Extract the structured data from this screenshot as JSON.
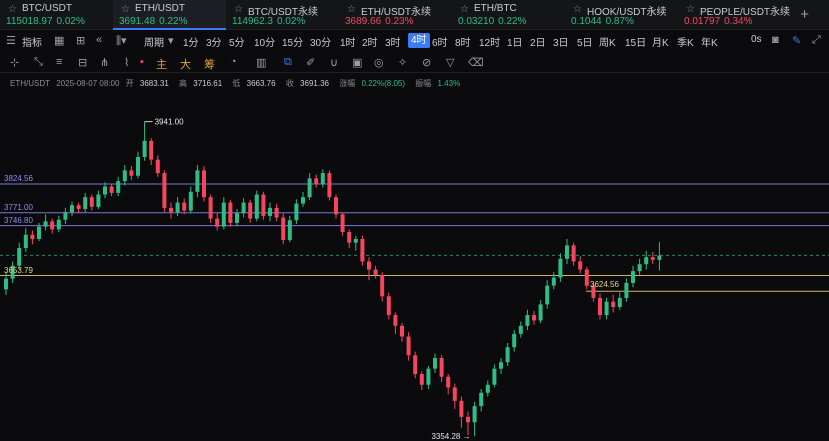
{
  "tickers": [
    {
      "name": "BTC/USDT",
      "price": "115018.97",
      "change": "0.02%",
      "dir": "up",
      "active": false
    },
    {
      "name": "ETH/USDT",
      "price": "3691.48",
      "change": "0.22%",
      "dir": "up",
      "active": true
    },
    {
      "name": "BTC/USDT永续",
      "price": "114962.3",
      "change": "0.02%",
      "dir": "up",
      "active": false
    },
    {
      "name": "ETH/USDT永续",
      "price": "3689.66",
      "change": "0.23%",
      "dir": "down",
      "active": false
    },
    {
      "name": "ETH/BTC",
      "price": "0.03210",
      "change": "0.22%",
      "dir": "up",
      "active": false
    },
    {
      "name": "HOOK/USDT永续",
      "price": "0.1044",
      "change": "0.87%",
      "dir": "up",
      "active": false
    },
    {
      "name": "PEOPLE/USDT永续",
      "price": "0.01797",
      "change": "0.34%",
      "dir": "down",
      "active": false
    }
  ],
  "toolbar": {
    "indicators_label": "指标",
    "period_label": "周期",
    "intervals": [
      "1分",
      "3分",
      "5分",
      "10分",
      "15分",
      "30分",
      "1时",
      "2时",
      "3时",
      "4时",
      "6时",
      "8时",
      "12时",
      "1日",
      "2日",
      "3日",
      "5日",
      "周K",
      "15日",
      "月K",
      "季K",
      "年K"
    ],
    "active_interval": "4时",
    "timer": "0s"
  },
  "drawtools": {
    "zhu": "主",
    "da": "大",
    "chou": "筹"
  },
  "info": {
    "symbol": "ETH/USDT",
    "datetime": "2025-08-07 08:00",
    "open_label": "开",
    "open": "3683.31",
    "high_label": "高",
    "high": "3716.61",
    "low_label": "低",
    "low": "3663.76",
    "close_label": "收",
    "close": "3691.36",
    "change_label": "涨幅",
    "change": "0.22%(8.05)",
    "amp_label": "振幅",
    "amp": "1.43%"
  },
  "chart_data": {
    "type": "candlestick",
    "price_range": [
      3345,
      4000
    ],
    "annotations": {
      "high": "3941.00",
      "low": "3354.28"
    },
    "levels": [
      {
        "label": "3824.56",
        "value": 3824.56,
        "color": "#8c8cf0"
      },
      {
        "label": "3771.00",
        "value": 3771.0,
        "color": "#8c8cf0"
      },
      {
        "label": "3746.80",
        "value": 3746.8,
        "color": "#8c8cf0"
      },
      {
        "label": "3653.79",
        "value": 3653.79,
        "color": "#e8d37a"
      },
      {
        "label": "3624.56",
        "value": 3624.56,
        "color": "#e8d37a"
      }
    ],
    "current_price": 3691.36,
    "candles": [
      [
        3628,
        3648,
        3618,
        3660
      ],
      [
        3648,
        3672,
        3640,
        3680
      ],
      [
        3672,
        3705,
        3665,
        3715
      ],
      [
        3705,
        3730,
        3698,
        3742
      ],
      [
        3730,
        3722,
        3712,
        3738
      ],
      [
        3722,
        3745,
        3718,
        3752
      ],
      [
        3745,
        3755,
        3738,
        3768
      ],
      [
        3755,
        3740,
        3732,
        3760
      ],
      [
        3740,
        3758,
        3735,
        3765
      ],
      [
        3758,
        3772,
        3750,
        3780
      ],
      [
        3772,
        3785,
        3765,
        3792
      ],
      [
        3785,
        3778,
        3770,
        3790
      ],
      [
        3778,
        3800,
        3772,
        3808
      ],
      [
        3800,
        3782,
        3775,
        3805
      ],
      [
        3782,
        3805,
        3778,
        3812
      ],
      [
        3805,
        3820,
        3798,
        3828
      ],
      [
        3820,
        3808,
        3802,
        3825
      ],
      [
        3808,
        3830,
        3802,
        3838
      ],
      [
        3830,
        3850,
        3822,
        3860
      ],
      [
        3850,
        3840,
        3832,
        3858
      ],
      [
        3840,
        3875,
        3835,
        3885
      ],
      [
        3875,
        3905,
        3868,
        3941
      ],
      [
        3905,
        3870,
        3860,
        3910
      ],
      [
        3870,
        3845,
        3838,
        3878
      ],
      [
        3845,
        3780,
        3772,
        3850
      ],
      [
        3780,
        3772,
        3760,
        3790
      ],
      [
        3772,
        3790,
        3765,
        3800
      ],
      [
        3790,
        3775,
        3768,
        3798
      ],
      [
        3775,
        3810,
        3770,
        3820
      ],
      [
        3810,
        3850,
        3800,
        3860
      ],
      [
        3850,
        3800,
        3792,
        3858
      ],
      [
        3800,
        3760,
        3752,
        3805
      ],
      [
        3760,
        3745,
        3738,
        3770
      ],
      [
        3745,
        3790,
        3740,
        3800
      ],
      [
        3790,
        3752,
        3745,
        3795
      ],
      [
        3752,
        3770,
        3746,
        3778
      ],
      [
        3770,
        3790,
        3762,
        3798
      ],
      [
        3790,
        3760,
        3752,
        3795
      ],
      [
        3760,
        3805,
        3755,
        3812
      ],
      [
        3805,
        3765,
        3758,
        3810
      ],
      [
        3765,
        3780,
        3755,
        3790
      ],
      [
        3780,
        3762,
        3755,
        3788
      ],
      [
        3762,
        3720,
        3712,
        3770
      ],
      [
        3720,
        3757,
        3716,
        3765
      ],
      [
        3757,
        3788,
        3750,
        3796
      ],
      [
        3788,
        3800,
        3782,
        3810
      ],
      [
        3800,
        3835,
        3795,
        3845
      ],
      [
        3835,
        3825,
        3818,
        3842
      ],
      [
        3825,
        3845,
        3818,
        3852
      ],
      [
        3845,
        3800,
        3794,
        3850
      ],
      [
        3800,
        3768,
        3760,
        3805
      ],
      [
        3768,
        3735,
        3728,
        3772
      ],
      [
        3735,
        3715,
        3705,
        3740
      ],
      [
        3715,
        3722,
        3700,
        3728
      ],
      [
        3722,
        3680,
        3672,
        3728
      ],
      [
        3680,
        3665,
        3645,
        3688
      ],
      [
        3665,
        3655,
        3648,
        3672
      ],
      [
        3655,
        3615,
        3605,
        3660
      ],
      [
        3615,
        3580,
        3572,
        3622
      ],
      [
        3580,
        3560,
        3545,
        3585
      ],
      [
        3560,
        3540,
        3530,
        3565
      ],
      [
        3540,
        3505,
        3495,
        3548
      ],
      [
        3505,
        3470,
        3462,
        3512
      ],
      [
        3470,
        3450,
        3440,
        3475
      ],
      [
        3450,
        3480,
        3442,
        3485
      ],
      [
        3480,
        3500,
        3472,
        3508
      ],
      [
        3500,
        3465,
        3455,
        3505
      ],
      [
        3465,
        3445,
        3432,
        3470
      ],
      [
        3445,
        3420,
        3405,
        3452
      ],
      [
        3420,
        3390,
        3370,
        3428
      ],
      [
        3390,
        3380,
        3356,
        3400
      ],
      [
        3380,
        3410,
        3354,
        3418
      ],
      [
        3410,
        3435,
        3400,
        3442
      ],
      [
        3435,
        3450,
        3428,
        3458
      ],
      [
        3450,
        3480,
        3445,
        3488
      ],
      [
        3480,
        3492,
        3470,
        3500
      ],
      [
        3492,
        3520,
        3485,
        3528
      ],
      [
        3520,
        3545,
        3512,
        3552
      ],
      [
        3545,
        3560,
        3538,
        3568
      ],
      [
        3560,
        3580,
        3552,
        3590
      ],
      [
        3580,
        3570,
        3562,
        3588
      ],
      [
        3570,
        3600,
        3565,
        3608
      ],
      [
        3600,
        3635,
        3592,
        3645
      ],
      [
        3635,
        3650,
        3628,
        3660
      ],
      [
        3650,
        3685,
        3642,
        3695
      ],
      [
        3685,
        3710,
        3675,
        3722
      ],
      [
        3710,
        3680,
        3672,
        3715
      ],
      [
        3680,
        3665,
        3658,
        3690
      ],
      [
        3665,
        3635,
        3628,
        3670
      ],
      [
        3635,
        3612,
        3605,
        3640
      ],
      [
        3612,
        3580,
        3572,
        3620
      ],
      [
        3580,
        3605,
        3572,
        3612
      ],
      [
        3605,
        3595,
        3585,
        3618
      ],
      [
        3595,
        3612,
        3590,
        3622
      ],
      [
        3612,
        3640,
        3605,
        3648
      ],
      [
        3640,
        3662,
        3632,
        3672
      ],
      [
        3662,
        3675,
        3655,
        3685
      ],
      [
        3675,
        3688,
        3665,
        3700
      ],
      [
        3688,
        3683,
        3675,
        3698
      ],
      [
        3683,
        3691,
        3663,
        3716
      ]
    ]
  }
}
